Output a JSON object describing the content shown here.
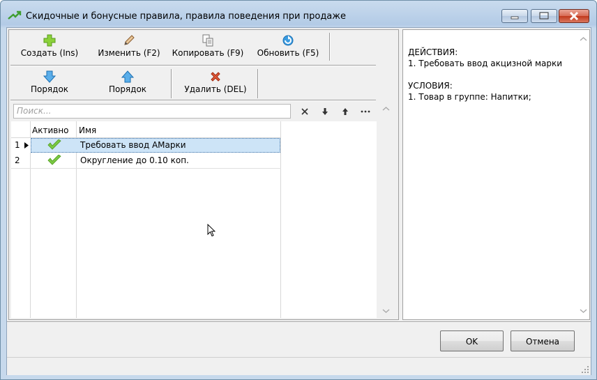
{
  "window": {
    "title": "Скидочные и бонусные правила, правила поведения при продаже"
  },
  "toolbar": {
    "row1": [
      {
        "label": "Создать (Ins)",
        "icon": "plus-icon"
      },
      {
        "label": "Изменить (F2)",
        "icon": "pencil-icon"
      },
      {
        "label": "Копировать (F9)",
        "icon": "copy-icon"
      },
      {
        "label": "Обновить (F5)",
        "icon": "refresh-icon"
      }
    ],
    "row2": [
      {
        "label": "Порядок",
        "icon": "arrow-down-icon"
      },
      {
        "label": "Порядок",
        "icon": "arrow-up-icon"
      },
      {
        "label": "Удалить (DEL)",
        "icon": "delete-icon"
      }
    ]
  },
  "search": {
    "placeholder": "Поиск...",
    "buttons": [
      "×",
      "🡇",
      "🡅",
      "···"
    ]
  },
  "grid": {
    "headers": {
      "active": "Активно",
      "name": "Имя"
    },
    "rows": [
      {
        "num": "1",
        "active": true,
        "name": "Требовать ввод АМарки"
      },
      {
        "num": "2",
        "active": true,
        "name": "Округление до 0.10 коп."
      }
    ]
  },
  "details": {
    "actions_heading": "ДЕЙСТВИЯ:",
    "actions_item": "1. Требовать ввод акцизной марки",
    "conditions_heading": "УСЛОВИЯ:",
    "conditions_item": "1. Товар в группе: Напитки;"
  },
  "buttons": {
    "ok": "OK",
    "cancel": "Отмена"
  },
  "colors": {
    "selection": "#cde4f7",
    "check": "#7ac943",
    "plus": "#8bd13a",
    "arrow": "#3a9be0",
    "delete": "#e05a3a"
  }
}
